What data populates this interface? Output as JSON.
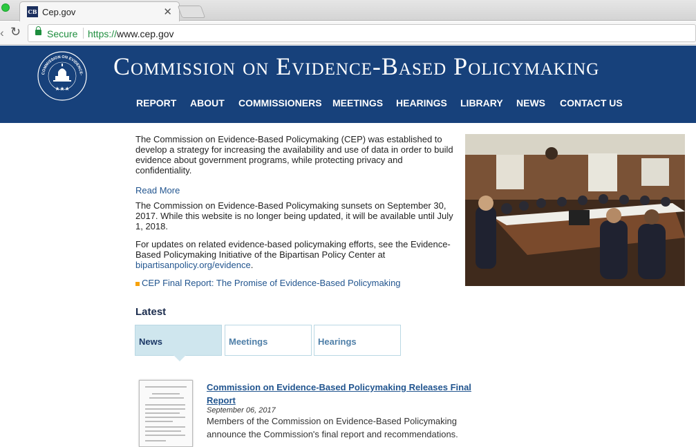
{
  "browser": {
    "tab_title": "Cep.gov",
    "favicon_text": "CB",
    "secure_label": "Secure",
    "url_scheme": "https://",
    "url_host": "www.cep.gov"
  },
  "header": {
    "title": "Commission on Evidence-Based Policymaking",
    "seal_text": "COMMISSION ON EVIDENCE-BASED POLICYMAKING",
    "nav": [
      "REPORT",
      "ABOUT",
      "COMMISSIONERS",
      "MEETINGS",
      "HEARINGS",
      "LIBRARY",
      "NEWS",
      "CONTACT US"
    ]
  },
  "intro": {
    "p1": "The Commission on Evidence-Based Policymaking (CEP) was established to develop a strategy for increasing the availability and use of data in order to build evidence about government programs, while protecting privacy and confidentiality.",
    "read_more": "Read More",
    "p2": "The Commission on Evidence-Based Policymaking sunsets on September 30, 2017. While this website is no longer being updated, it will be available until July 1, 2018.",
    "p3_prefix": "For updates on related evidence-based policymaking efforts, see the Evidence-Based Policymaking Initiative of the Bipartisan Policy Center at",
    "p3_link": "bipartisanpolicy.org/evidence",
    "p3_suffix": ".",
    "final_report_link": "CEP Final Report: The Promise of Evidence-Based Policymaking"
  },
  "latest": {
    "heading": "Latest",
    "tabs": [
      "News",
      "Meetings",
      "Hearings"
    ],
    "active_tab": "News",
    "item": {
      "title": "Commission on Evidence-Based Policymaking Releases Final Report",
      "date": "September 06, 2017",
      "description": "Members of the Commission on Evidence-Based Policymaking announce the Commission's final report and recommendations."
    }
  },
  "colors": {
    "header_bg": "#17417b",
    "link": "#22558f",
    "active_tab_bg": "#cfe6ee",
    "bullet": "#f7a20c",
    "secure_green": "#1e8e3e"
  }
}
